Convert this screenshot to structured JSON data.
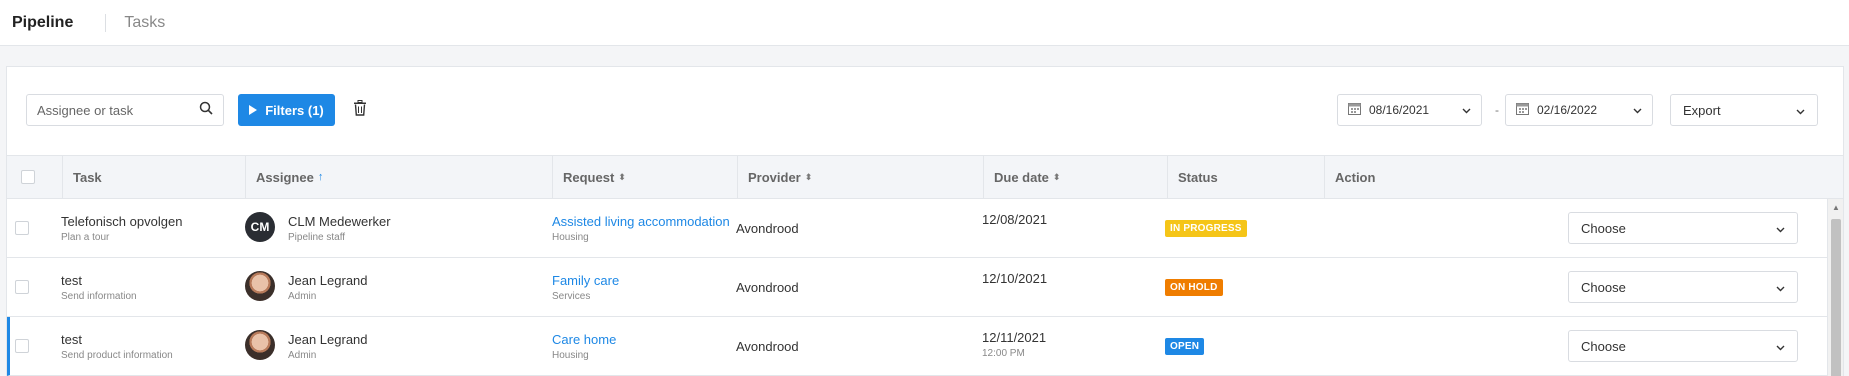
{
  "nav": {
    "tabs": [
      {
        "label": "Pipeline"
      },
      {
        "label": "Tasks"
      }
    ]
  },
  "toolbar": {
    "search_placeholder": "Assignee or task",
    "filters_label": "Filters (1)",
    "date_from": "08/16/2021",
    "date_separator": "-",
    "date_to": "02/16/2022",
    "export_label": "Export"
  },
  "table": {
    "headers": {
      "task": "Task",
      "assignee": "Assignee",
      "request": "Request",
      "provider": "Provider",
      "due_date": "Due date",
      "status": "Status",
      "action": "Action"
    },
    "rows": [
      {
        "task": "Telefonisch opvolgen",
        "task_sub": "Plan a tour",
        "avatar_initials": "CM",
        "assignee": "CLM Medewerker",
        "assignee_role": "Pipeline staff",
        "request": "Assisted living accommodation",
        "request_sub": "Housing",
        "provider": "Avondrood",
        "due_date": "12/08/2021",
        "due_time": "",
        "status": "IN PROGRESS",
        "status_color": "#f5c518",
        "action": "Choose"
      },
      {
        "task": "test",
        "task_sub": "Send information",
        "avatar_initials": "",
        "assignee": "Jean Legrand",
        "assignee_role": "Admin",
        "request": "Family care",
        "request_sub": "Services",
        "provider": "Avondrood",
        "due_date": "12/10/2021",
        "due_time": "",
        "status": "ON HOLD",
        "status_color": "#ef7d00",
        "action": "Choose"
      },
      {
        "task": "test",
        "task_sub": "Send product information",
        "avatar_initials": "",
        "assignee": "Jean Legrand",
        "assignee_role": "Admin",
        "request": "Care home",
        "request_sub": "Housing",
        "provider": "Avondrood",
        "due_date": "12/11/2021",
        "due_time": "12:00 PM",
        "status": "OPEN",
        "status_color": "#1e88e5",
        "action": "Choose"
      }
    ]
  },
  "icons": {
    "search": "search-icon",
    "filter_play": "play-icon",
    "trash": "trash-icon",
    "calendar": "calendar-icon",
    "chevron": "chevron-down-icon"
  }
}
